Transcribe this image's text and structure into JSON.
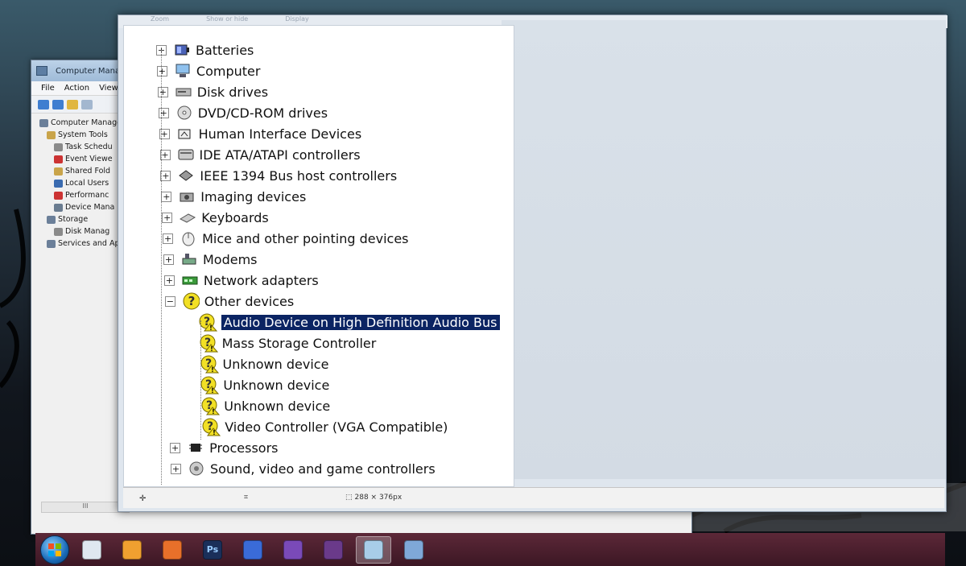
{
  "cm_window": {
    "title": "Computer Manag",
    "menu": [
      "File",
      "Action",
      "View"
    ],
    "tree": [
      {
        "label": "Computer Manage",
        "indent": 0,
        "color": "#6b7f99"
      },
      {
        "label": "System Tools",
        "indent": 1,
        "color": "#c9a44a"
      },
      {
        "label": "Task Schedu",
        "indent": 2,
        "color": "#8a8a8a"
      },
      {
        "label": "Event Viewe",
        "indent": 2,
        "color": "#c33"
      },
      {
        "label": "Shared Fold",
        "indent": 2,
        "color": "#c9a44a"
      },
      {
        "label": "Local Users",
        "indent": 2,
        "color": "#3a6bb0"
      },
      {
        "label": "Performanc",
        "indent": 2,
        "color": "#c33"
      },
      {
        "label": "Device Mana",
        "indent": 2,
        "color": "#6a7c90"
      },
      {
        "label": "Storage",
        "indent": 1,
        "color": "#6b7f99"
      },
      {
        "label": "Disk Manag",
        "indent": 2,
        "color": "#8a8a8a"
      },
      {
        "label": "Services and Ap",
        "indent": 1,
        "color": "#6b7f99"
      }
    ],
    "scroll_label": "III"
  },
  "dm_window": {
    "header": [
      "Zoom",
      "Show or hide",
      "Display"
    ],
    "devices": [
      {
        "label": "Batteries",
        "icon": "battery-icon",
        "expanded": false
      },
      {
        "label": "Computer",
        "icon": "computer-icon",
        "expanded": false
      },
      {
        "label": "Disk drives",
        "icon": "disk-drive-icon",
        "expanded": false
      },
      {
        "label": "DVD/CD-ROM drives",
        "icon": "dvd-drive-icon",
        "expanded": false
      },
      {
        "label": "Human Interface Devices",
        "icon": "hid-icon",
        "expanded": false
      },
      {
        "label": "IDE ATA/ATAPI controllers",
        "icon": "ide-controller-icon",
        "expanded": false
      },
      {
        "label": "IEEE 1394 Bus host controllers",
        "icon": "ieee1394-icon",
        "expanded": false
      },
      {
        "label": "Imaging devices",
        "icon": "camera-icon",
        "expanded": false
      },
      {
        "label": "Keyboards",
        "icon": "keyboard-icon",
        "expanded": false
      },
      {
        "label": "Mice and other pointing devices",
        "icon": "mouse-icon",
        "expanded": false
      },
      {
        "label": "Modems",
        "icon": "modem-icon",
        "expanded": false
      },
      {
        "label": "Network adapters",
        "icon": "network-adapter-icon",
        "expanded": false
      },
      {
        "label": "Other devices",
        "icon": "unknown-device-icon",
        "expanded": true
      }
    ],
    "other_devices": [
      {
        "label": "Audio Device on High Definition Audio Bus",
        "selected": true
      },
      {
        "label": "Mass Storage Controller",
        "selected": false
      },
      {
        "label": "Unknown device",
        "selected": false
      },
      {
        "label": "Unknown device",
        "selected": false
      },
      {
        "label": "Unknown device",
        "selected": false
      },
      {
        "label": "Video Controller (VGA Compatible)",
        "selected": false
      }
    ],
    "devices_after": [
      {
        "label": "Processors",
        "icon": "processor-icon",
        "expanded": false
      },
      {
        "label": "Sound, video and game controllers",
        "icon": "speaker-icon",
        "expanded": false
      }
    ],
    "status": {
      "dimensions": "288 × 376px"
    }
  },
  "taskbar": {
    "items": [
      "start-orb",
      "virtualbox",
      "media-player",
      "firefox",
      "photoshop",
      "pidgin",
      "irfanview",
      "pinnacle",
      "paint",
      "device-manager"
    ],
    "active": 8
  },
  "colors": {
    "selection": "#0b2463",
    "warning": "#f2e025"
  }
}
